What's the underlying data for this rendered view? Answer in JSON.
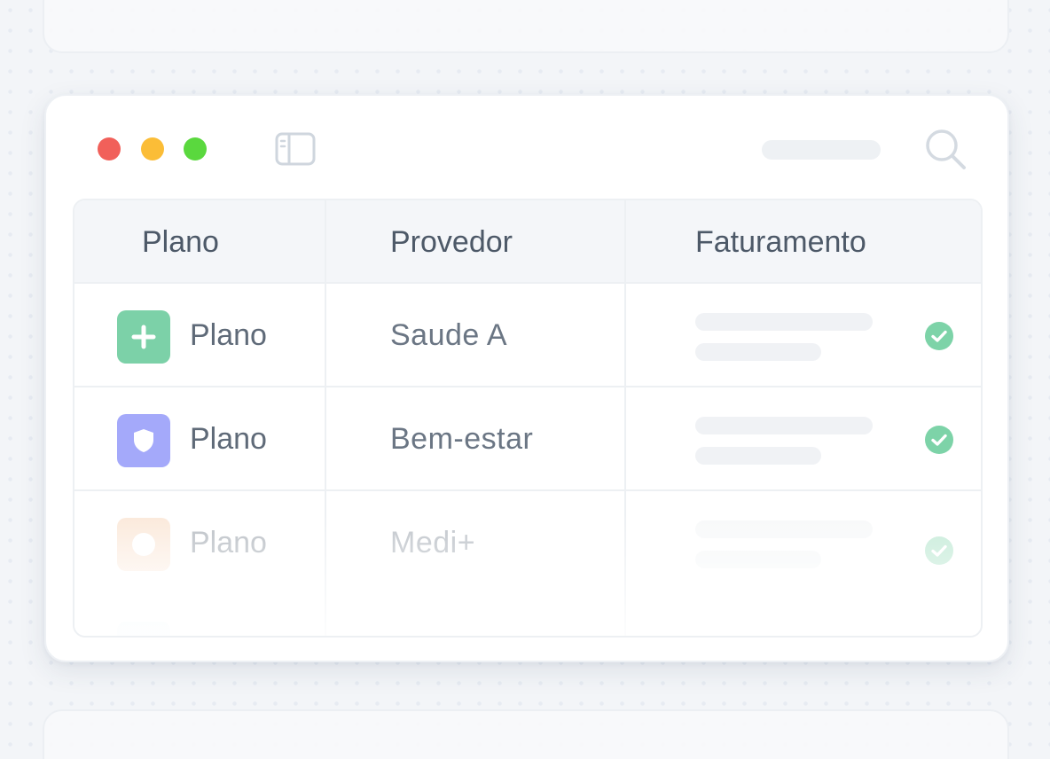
{
  "colors": {
    "traffic_red": "#f1605a",
    "traffic_yellow": "#fbbd37",
    "traffic_green": "#5ad83e",
    "check_green": "#7dd3a8"
  },
  "table": {
    "headers": [
      "Plano",
      "Provedor",
      "Faturamento"
    ],
    "rows": [
      {
        "icon": "plus-icon",
        "icon_color": "#7cd1a8",
        "plan": "Plano",
        "provider": "Saude A",
        "status_icon": "check-icon"
      },
      {
        "icon": "shield-icon",
        "icon_color": "#a4a9fa",
        "plan": "Plano",
        "provider": "Bem-estar",
        "status_icon": "check-icon"
      },
      {
        "icon": "circle-icon",
        "icon_color": "#f6cba8",
        "plan": "Plano",
        "provider": "Medi+",
        "status_icon": "check-icon"
      }
    ]
  }
}
